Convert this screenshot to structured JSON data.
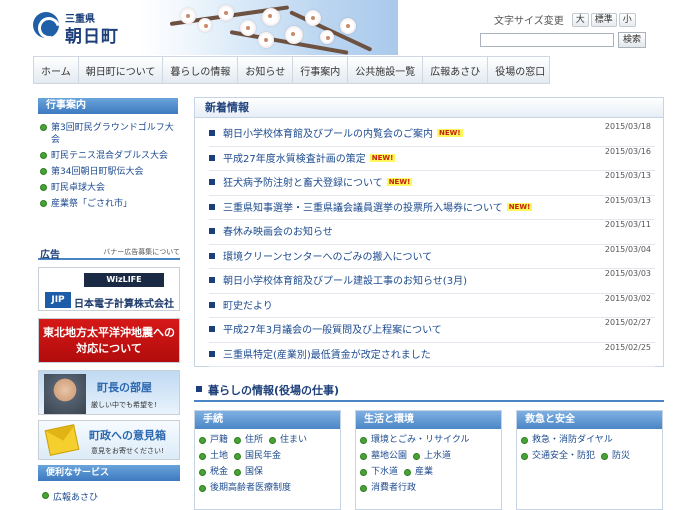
{
  "header": {
    "pref_name": "三重県",
    "town_name": "朝日町",
    "fontsize_label": "文字サイズ変更",
    "fontsize_buttons": [
      "大",
      "標準",
      "小"
    ],
    "search_placeholder": "",
    "search_button": "検索"
  },
  "nav": [
    "ホーム",
    "朝日町について",
    "暮らしの情報",
    "お知らせ",
    "行事案内",
    "公共施設一覧",
    "広報あさひ",
    "役場の窓口"
  ],
  "sidebar": {
    "events_title": "行事案内",
    "events": [
      "第3回町民グラウンドゴルフ大会",
      "町民テニス混合ダブルス大会",
      "第34回朝日町駅伝大会",
      "町民卓球大会",
      "産業祭「ごされ市」"
    ],
    "ad_title": "広告",
    "ad_recruit": "バナー広告募集について",
    "ad_wiz_logo": "WizLIFE",
    "ad_company": "日本電子計算株式会社",
    "ad_company_mark": "JIP",
    "quake_banner": "東北地方太平洋沖地震への対応について",
    "mayor_title": "町長の部屋",
    "mayor_sub": "厳しい中でも希望を!",
    "opinion_title": "町政への意見箱",
    "opinion_sub": "意見をお寄せください!",
    "services_title": "便利なサービス",
    "services": [
      "広報あさひ"
    ]
  },
  "news": {
    "title": "新着情報",
    "new_label": "NEW!",
    "items": [
      {
        "title": "朝日小学校体育館及びプールの内覧会のご案内",
        "date": "2015/03/18",
        "new": "NEW!"
      },
      {
        "title": "平成27年度水質検査計画の策定",
        "date": "2015/03/16",
        "new": "NEW!"
      },
      {
        "title": "狂犬病予防注射と畜犬登録について",
        "date": "2015/03/13",
        "new": "NEW!"
      },
      {
        "title": "三重県知事選挙・三重県議会議員選挙の投票所入場券について",
        "date": "2015/03/13",
        "new": "NEW!"
      },
      {
        "title": "春休み映画会のお知らせ",
        "date": "2015/03/11",
        "new": ""
      },
      {
        "title": "環境クリーンセンターへのごみの搬入について",
        "date": "2015/03/04",
        "new": ""
      },
      {
        "title": "朝日小学校体育館及びプール建設工事のお知らせ(3月)",
        "date": "2015/03/03",
        "new": ""
      },
      {
        "title": "町史だより",
        "date": "2015/03/02",
        "new": ""
      },
      {
        "title": "平成27年3月議会の一般質問及び上程案について",
        "date": "2015/02/27",
        "new": ""
      },
      {
        "title": "三重県特定(産業別)最低賃金が改定されました",
        "date": "2015/02/25",
        "new": ""
      }
    ]
  },
  "life": {
    "title": "暮らしの情報(役場の仕事)",
    "categories": [
      {
        "title": "手続",
        "rows": [
          [
            "戸籍",
            "住所",
            "住まい"
          ],
          [
            "土地",
            "国民年金"
          ],
          [
            "税金",
            "国保"
          ],
          [
            "後期高齢者医療制度"
          ]
        ]
      },
      {
        "title": "生活と環境",
        "rows": [
          [
            "環境とごみ・リサイクル"
          ],
          [
            "墓地公園",
            "上水道"
          ],
          [
            "下水道",
            "産業"
          ],
          [
            "消費者行政"
          ]
        ]
      },
      {
        "title": "救急と安全",
        "rows": [
          [
            "救急・消防ダイヤル"
          ],
          [
            "交通安全・防犯",
            "防災"
          ]
        ]
      }
    ]
  }
}
